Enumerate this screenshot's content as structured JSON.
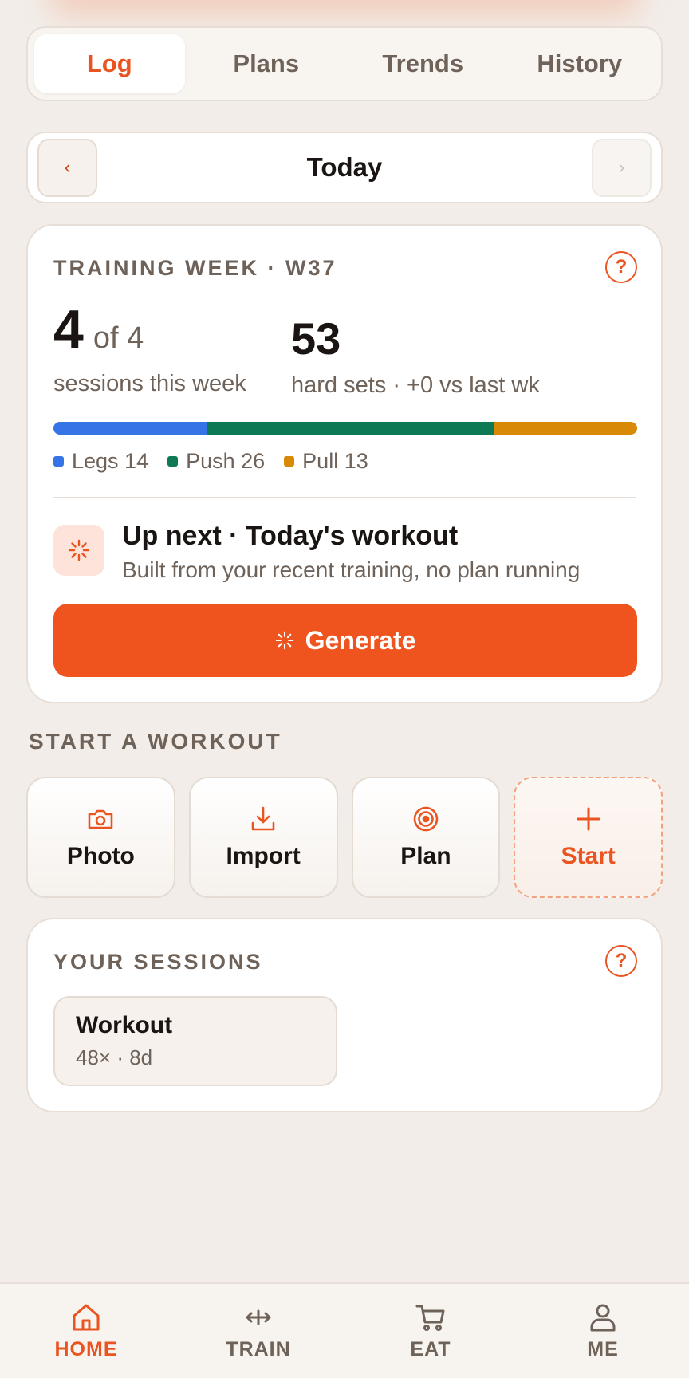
{
  "tabs": [
    {
      "label": "Log",
      "active": true
    },
    {
      "label": "Plans",
      "active": false
    },
    {
      "label": "Trends",
      "active": false
    },
    {
      "label": "History",
      "active": false
    }
  ],
  "day_nav": {
    "prev": "‹",
    "title": "Today",
    "next": "›"
  },
  "training_week": {
    "eyebrow": "TRAINING WEEK · W37",
    "help": "?",
    "sessions_done": "4",
    "sessions_of": "of 4",
    "sessions_label": "sessions this week",
    "hard_sets": "53",
    "hard_sets_label": "hard sets · +0 vs last wk",
    "breakdown": [
      {
        "name": "Legs 14",
        "value": 14,
        "color": "#3574e6"
      },
      {
        "name": "Push 26",
        "value": 26,
        "color": "#0e7a55"
      },
      {
        "name": "Pull 13",
        "value": 13,
        "color": "#d88a06"
      }
    ],
    "up_next_title": "Up next · Today's workout",
    "up_next_sub": "Built from your recent training, no plan running",
    "generate_label": "Generate"
  },
  "start_workout": {
    "label": "START A WORKOUT",
    "actions": [
      {
        "label": "Photo",
        "icon": "camera-icon"
      },
      {
        "label": "Import",
        "icon": "download-icon"
      },
      {
        "label": "Plan",
        "icon": "target-icon"
      },
      {
        "label": "Start",
        "icon": "plus-icon"
      }
    ]
  },
  "sessions": {
    "label": "YOUR SESSIONS",
    "help": "?",
    "items": [
      {
        "title": "Workout",
        "sub": "48× · 8d"
      }
    ]
  },
  "bottom_nav": [
    {
      "label": "HOME",
      "icon": "home-icon",
      "active": true
    },
    {
      "label": "TRAIN",
      "icon": "arrows-icon",
      "active": false
    },
    {
      "label": "EAT",
      "icon": "cart-icon",
      "active": false
    },
    {
      "label": "ME",
      "icon": "person-icon",
      "active": false
    }
  ],
  "colors": {
    "accent": "#f0541e",
    "background": "#f2ede8"
  }
}
